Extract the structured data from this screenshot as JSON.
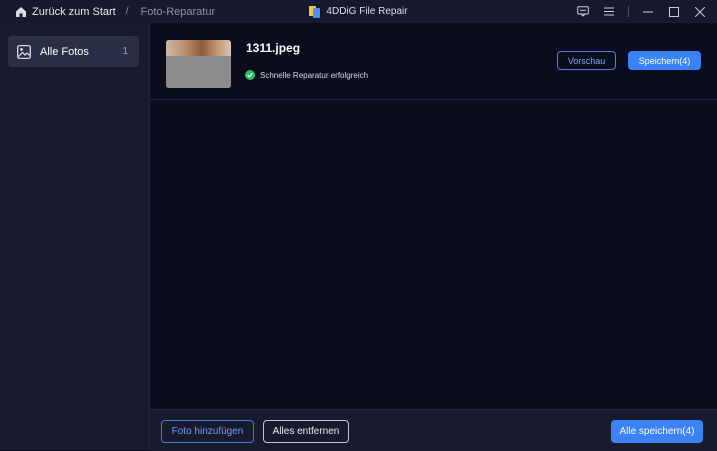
{
  "titlebar": {
    "back_label": "Zurück zum Start",
    "separator": "/",
    "breadcrumb": "Foto-Reparatur",
    "app_title": "4DDiG File Repair",
    "icons": [
      "home-icon",
      "app-logo-icon",
      "feedback-icon",
      "menu-icon",
      "minimize-icon",
      "maximize-icon",
      "close-icon"
    ]
  },
  "sidebar": {
    "items": [
      {
        "label": "Alle Fotos",
        "count": "1",
        "icon": "image-icon"
      }
    ]
  },
  "files": [
    {
      "name": "1311.jpeg",
      "status": "Schnelle Reparatur erfolgreich",
      "status_icon": "check-circle-icon",
      "preview_label": "Vorschau",
      "save_label": "Speichern(4)"
    }
  ],
  "footer": {
    "add_label": "Foto hinzufügen",
    "remove_label": "Alles entfernen",
    "save_all_label": "Alle speichern(4)"
  },
  "colors": {
    "accent": "#3b82f6",
    "success": "#22c55e",
    "background": "#0b0d1f",
    "panel": "#181b2e"
  }
}
